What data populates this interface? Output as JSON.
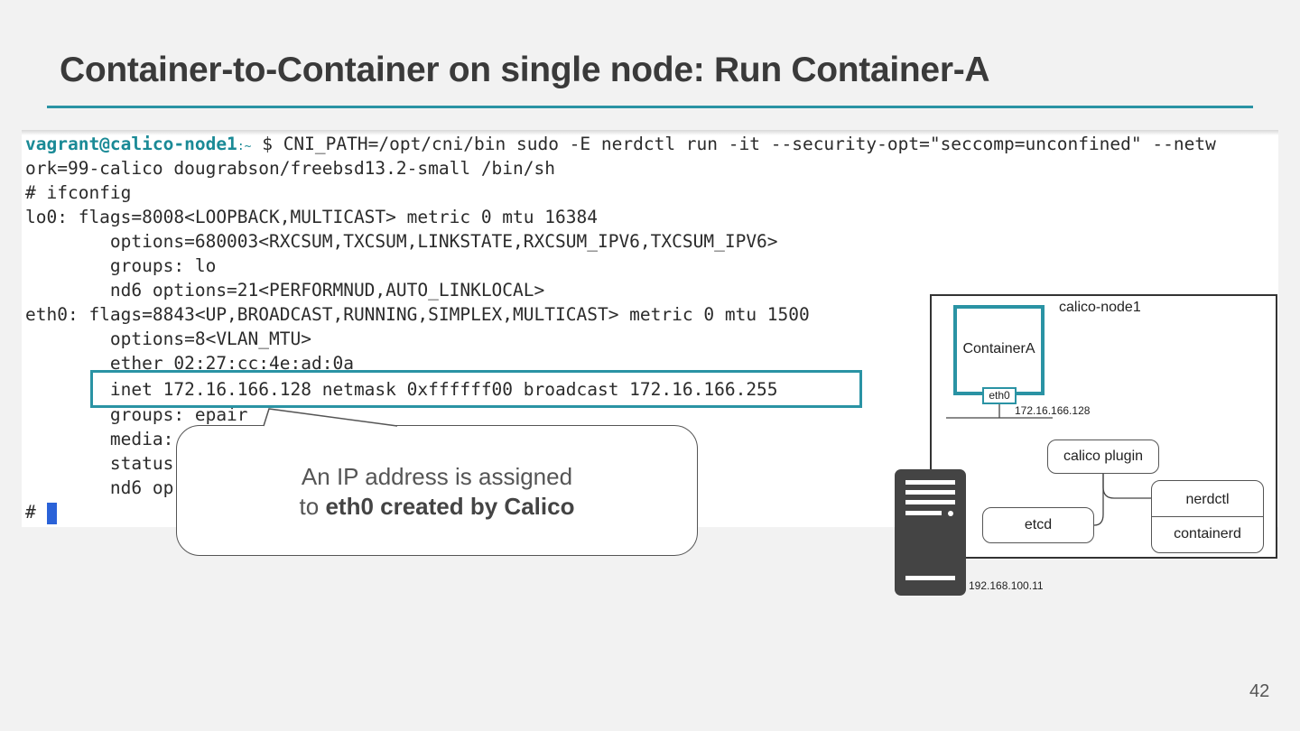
{
  "slide": {
    "title": "Container-to-Container on single node: Run Container-A",
    "page_number": "42"
  },
  "terminal": {
    "prompt_user": "vagrant@calico-node1",
    "prompt_path": ":~",
    "prompt_cmd": " $ CNI_PATH=/opt/cni/bin sudo -E nerdctl run -it --security-opt=\"seccomp=unconfined\" --netw",
    "lines": [
      "ork=99-calico dougrabson/freebsd13.2-small /bin/sh",
      "# ifconfig",
      "lo0: flags=8008<LOOPBACK,MULTICAST> metric 0 mtu 16384",
      "        options=680003<RXCSUM,TXCSUM,LINKSTATE,RXCSUM_IPV6,TXCSUM_IPV6>",
      "        groups: lo",
      "        nd6 options=21<PERFORMNUD,AUTO_LINKLOCAL>",
      "eth0: flags=8843<UP,BROADCAST,RUNNING,SIMPLEX,MULTICAST> metric 0 mtu 1500",
      "        options=8<VLAN_MTU>",
      "        ether 02:27:cc:4e:ad:0a",
      "        inet 172.16.166.128 netmask 0xffffff00 broadcast 172.16.166.255",
      "        groups: epair",
      "        media:",
      "        status",
      "        nd6 op"
    ],
    "last_prompt": "#"
  },
  "callout": {
    "line1": "An IP address is assigned",
    "line2_prefix": "to ",
    "line2_bold": "eth0 created by Calico"
  },
  "diagram": {
    "node_label": "calico-node1",
    "container_label": "ContainerA",
    "eth0_label": "eth0",
    "container_ip": "172.16.166.128",
    "calico_plugin": "calico plugin",
    "etcd": "etcd",
    "nerdctl": "nerdctl",
    "containerd": "containerd",
    "host_ip": "192.168.100.11",
    "accent_color": "#2a93a4",
    "server_icon": "server-icon"
  }
}
